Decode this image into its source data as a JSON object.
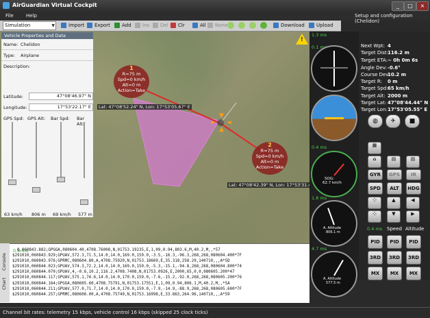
{
  "window": {
    "title": "AirGuardian Virtual Cockpit",
    "setup_label": "Setup and configuration (Chelidon)"
  },
  "menu": {
    "items": [
      "File",
      "Help"
    ]
  },
  "toolbar": {
    "mode": "Simulation",
    "import": "Import",
    "export": "Export",
    "add": "Add",
    "ins": "Ins",
    "del": "Del",
    "clr": "Clr",
    "all": "All",
    "none": "None",
    "download": "Download",
    "upload": "Upload"
  },
  "vehicle": {
    "header": "Vehicle Properties and Data",
    "name_label": "Name:",
    "name": "Chelidon",
    "type_label": "Type:",
    "type": "Airplane",
    "desc_label": "Description:",
    "lat_label": "Latitude:",
    "lat": "47°08'46.97\" N",
    "lon_label": "Longitude:",
    "lon": "17°53'22.17\" E",
    "slider_labels": [
      "GPS Spd:",
      "GPS Alt:",
      "Bar Spd:",
      "Bar Alt:"
    ],
    "slider_values": [
      "63 km/h",
      "806 m",
      "69 km/h",
      "577 m"
    ]
  },
  "waypoints": [
    {
      "num": "1",
      "lines": [
        "R=75 m",
        "Spd=0 km/h",
        "Alt=0 m",
        "Action=Take"
      ]
    },
    {
      "num": "2",
      "lines": [
        "R=75 m",
        "Spd=0 km/h",
        "Alt=0 m",
        "Action=Take"
      ]
    }
  ],
  "map": {
    "cursor_coord": "Lat: 47°08'52.24\" N, Lon: 17°53'05.67\" E",
    "wp2_coord": "Lat: 47°08'42.39\" N, Lon: 17°53'31.48"
  },
  "instruments": {
    "ms": [
      "1.3 ms",
      "0.1 ms",
      "0.4 ms",
      "1.8 ms",
      "4.7 ms"
    ],
    "speed_label": "SOG:",
    "speed_value": "62.7 km/h",
    "alt_label": "A. Altitude",
    "alt_value": "806.1 m",
    "alt2_value": "577.5 m"
  },
  "telemetry": {
    "labels": [
      "Next Wpt:",
      "Target Dist:",
      "Target ETA:",
      "Angle Dev:",
      "Course Dev:",
      "Target R:",
      "Target Spd:",
      "Target Alt:",
      "Target Lat:",
      "Target Lon:"
    ],
    "values": [
      "4",
      "116.2 m",
      "~ 0h 0m 6s",
      "-0.6°",
      "10.2 m",
      "0 m",
      "65 km/h",
      "2000 m",
      "47°08'44.44\" N",
      "17°53'05.55\" E"
    ]
  },
  "controls": {
    "gyr": "GYR",
    "gps": "GPS",
    "ir": "IR",
    "spd": "SPD",
    "alt": "ALT",
    "hdg": "HDG",
    "ms": "0.4 ms",
    "speed": "Speed",
    "altitude": "Altitude",
    "pid": "PID",
    "three_rd": "3RD",
    "mx": "MX"
  },
  "console": {
    "tabs": [
      "Console",
      "Chart"
    ],
    "ms": "0.8 ms",
    "lines": [
      "  0,060843.882;GPGGA,080604.40,4708.76008,N,01753.19235,E,1,09,0.94,803.6,M,40.2,M,,*57",
      "$291010,060843.929;GPUAV,572.3,71.5,14.0,14.0,169.0,159.0,-3.5,-16.3,-96.3,268,268,080604.400*7F",
      "$291010,060843.976;GPRMC,080604.80,A,4708.75920,N,01753.18669,E,35.318,258.29,140710,,,A*5D",
      "$291010,060844.023;GPUAV,574.3,72.2,14.0,14.0,169.0,159.0,-5.3,-15.1,-94.8,268,268,080604.800*74",
      "$291010,060844.070;GPUAV,4,-0.6,10.2,116.2,4708.7408,N,01753.0926,E,2000,65,0,0,080605.200*47",
      "$291010,060844.117;GPUAV,575.1,74.6,14.0,14.0,170.0,159.0,-7.6,-15.2,-92.0,268,268,080605.200*76",
      "$291010,060844.164;GPGGA,080605.60,4708.75791,N,01753.17551,E,1,09,0.94,806.1,M,40.2,M,,*5A",
      "$291010,060844.211;GPUAV,577.0,71.7,14.0,14.0,170.0,159.0,-7.9,-14.9,-88.9,268,268,080605.600*7F",
      "$291010,060844.257;GPRMC,080606.00,A,4708.75749,N,01753.16998,E,33.863,264.96,140710,,,A*59"
    ]
  },
  "status": {
    "text": "Channel bit rates: telemetry 15 kbps, vehicle control 16 kbps (skipped 25 clock ticks)"
  }
}
